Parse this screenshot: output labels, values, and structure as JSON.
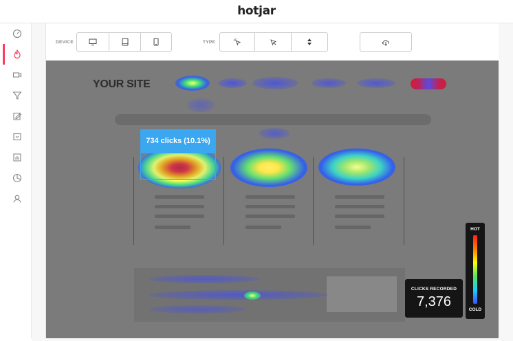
{
  "header": {
    "logo_text": "hotjar"
  },
  "sidebar": {
    "items": [
      {
        "icon": "dashboard-icon",
        "active": false
      },
      {
        "icon": "heatmap-flame-icon",
        "active": true
      },
      {
        "icon": "recordings-camera-icon",
        "active": false
      },
      {
        "icon": "funnels-icon",
        "active": false
      },
      {
        "icon": "forms-edit-icon",
        "active": false
      },
      {
        "icon": "polls-icon",
        "active": false
      },
      {
        "icon": "reports-chart-icon",
        "active": false
      },
      {
        "icon": "analytics-pie-icon",
        "active": false
      },
      {
        "icon": "users-icon",
        "active": false
      }
    ]
  },
  "toolbar": {
    "device_label": "DEVICE",
    "type_label": "TYPE",
    "device_buttons": [
      "desktop-icon",
      "tablet-icon",
      "phone-icon"
    ],
    "type_buttons": [
      "click-icon",
      "move-icon",
      "scroll-icon"
    ],
    "download_icon": "cloud-download-icon"
  },
  "heatmap": {
    "site_title": "YOUR SITE",
    "tooltip": "734 clicks (10.1%)",
    "clicks_recorded_label": "CLICKS RECORDED",
    "clicks_recorded_value": "7,376",
    "legend_hot": "HOT",
    "legend_cold": "COLD"
  },
  "colors": {
    "accent": "#fd3a5c",
    "tooltip": "#3aa7f0",
    "overlay": "#7b7b7b"
  }
}
